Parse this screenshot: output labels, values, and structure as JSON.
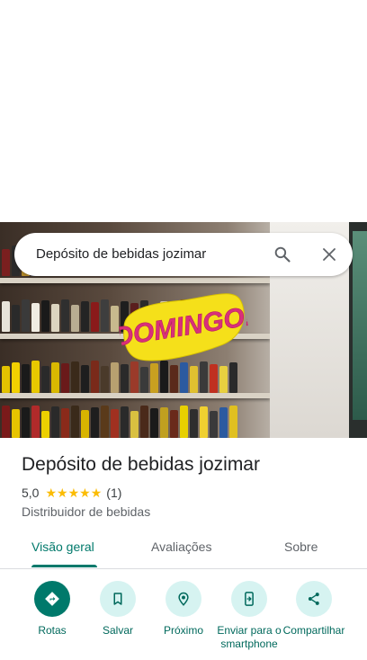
{
  "search": {
    "query": "Depósito de bebidas jozimar"
  },
  "photo": {
    "sticker_text": "DOMINGO!"
  },
  "place": {
    "name": "Depósito de bebidas jozimar",
    "rating": "5,0",
    "stars": 5,
    "review_count": "(1)",
    "category": "Distribuidor de bebidas"
  },
  "tabs": [
    {
      "label": "Visão geral",
      "active": true
    },
    {
      "label": "Avaliações",
      "active": false
    },
    {
      "label": "Sobre",
      "active": false
    }
  ],
  "actions": [
    {
      "label": "Rotas",
      "icon": "directions-icon"
    },
    {
      "label": "Salvar",
      "icon": "bookmark-icon"
    },
    {
      "label": "Próximo",
      "icon": "nearby-icon"
    },
    {
      "label": "Enviar para o smartphone",
      "icon": "send-to-phone-icon"
    },
    {
      "label": "Compartilhar",
      "icon": "share-icon"
    }
  ],
  "colors": {
    "accent": "#00796b",
    "action_bg": "#d6f3f1",
    "star": "#fbbc04"
  }
}
